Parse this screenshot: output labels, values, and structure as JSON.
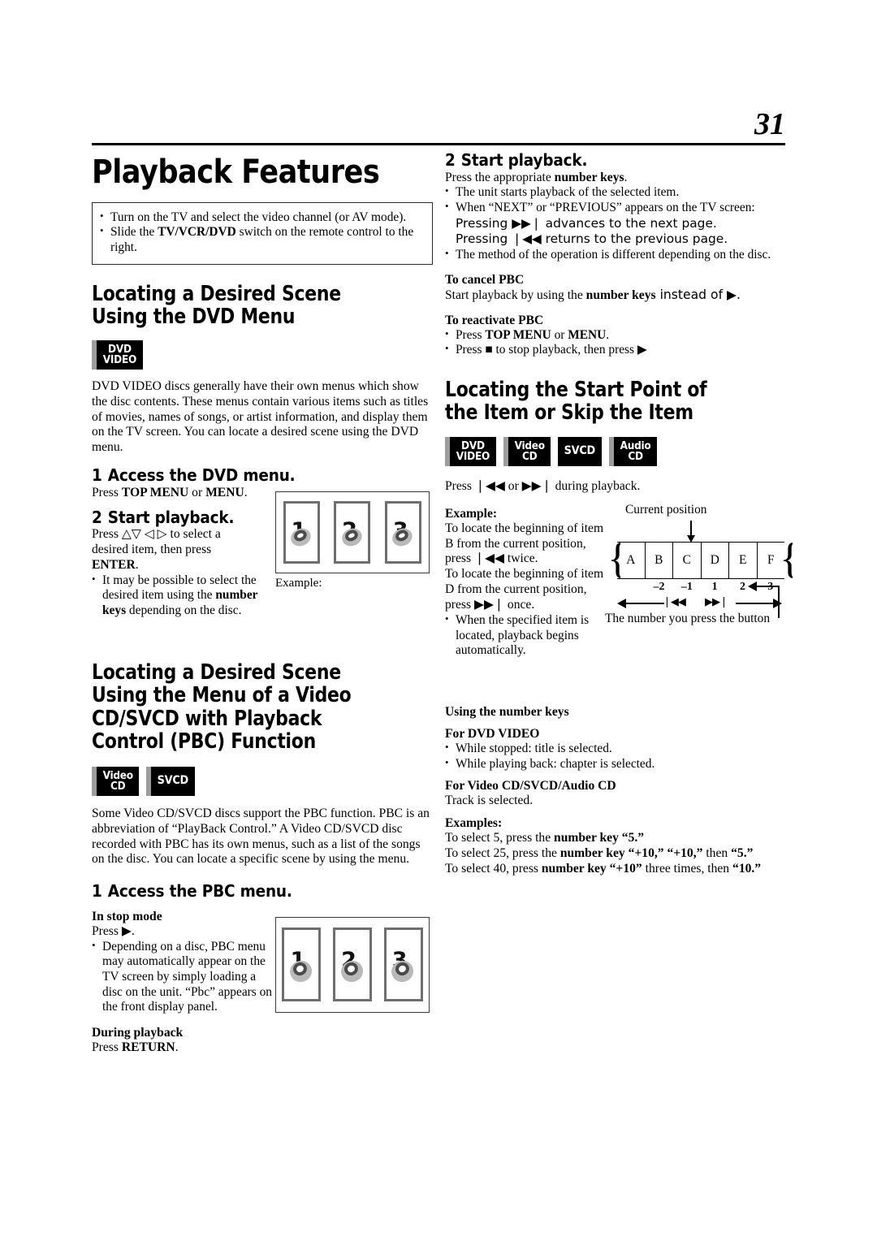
{
  "page": {
    "number": "31"
  },
  "left": {
    "title": "Playback Features",
    "notes": [
      "Turn on the TV and select the video channel (or AV mode).",
      "Slide the TV/VCR/DVD switch on the remote control to the right."
    ],
    "note_bold_1": "TV/VCR/DVD",
    "section1": {
      "heading": "Locating a Desired Scene Using the DVD Menu",
      "badges": [
        {
          "name": "dvd-video-badge",
          "lines": [
            "DVD",
            "VIDEO"
          ],
          "bar": true
        }
      ],
      "body": "DVD VIDEO discs generally have their own menus which show the disc contents. These menus contain various items such as titles of movies, names of songs, or artist information, and display them on the TV screen. You can locate a desired scene using the DVD menu.",
      "step1_num": "1",
      "step1_label": "Access the DVD menu.",
      "step1_body_pre": "Press ",
      "step1_body_bold1": "TOP MENU",
      "step1_body_mid": " or ",
      "step1_body_bold2": "MENU",
      "step1_body_post": ".",
      "step2_num": "2",
      "step2_label": "Start playback.",
      "step2_line1": "Press △▽ ◁ ▷ to select a",
      "step2_line2": "desired item, then press",
      "step2_line3_bold": "ENTER",
      "step2_line3_post": ".",
      "step2_bullet_a": "It may be possible to select the desired item using the ",
      "step2_bullet_b": "number keys",
      "step2_bullet_c": " depending on the disc.",
      "example_caption": "Example:",
      "panels": [
        "1",
        "2",
        "3"
      ]
    },
    "section2": {
      "heading": "Locating a Desired Scene Using the Menu of a Video CD/SVCD with Playback Control (PBC) Function",
      "badges": [
        {
          "name": "video-cd-badge",
          "lines": [
            "Video",
            "CD"
          ],
          "bar": true
        },
        {
          "name": "svcd-badge",
          "lines": [
            "SVCD"
          ],
          "bar": true
        }
      ],
      "body": "Some Video CD/SVCD discs support the PBC function. PBC is an abbreviation of “PlayBack Control.” A Video CD/SVCD disc recorded with PBC has its own menus, such as a list of the songs on the disc. You can locate a specific scene by using the menu.",
      "step1_num": "1",
      "step1_label": "Access the PBC menu.",
      "stop_mode_heading": "In stop mode",
      "stop_mode_press": "Press ▶.",
      "stop_mode_bullet": "Depending on a disc, PBC menu may automatically appear on the TV screen by simply loading a disc on the unit. “Pbc” appears on the front display panel.",
      "during_playback_heading": "During playback",
      "during_playback_press_pre": "Press ",
      "during_playback_press_bold": "RETURN",
      "during_playback_press_post": ".",
      "panels": [
        "1",
        "2",
        "3"
      ]
    }
  },
  "right": {
    "step2_num": "2",
    "step2_label": "Start playback.",
    "step2_lead_pre": "Press the appropriate ",
    "step2_lead_bold": "number keys",
    "step2_lead_post": ".",
    "step2_bullets": [
      "The unit starts playback of the selected item.",
      "When “NEXT” or “PREVIOUS” appears on the TV screen:",
      "The method of the operation is different depending on the disc."
    ],
    "step2_sub_line1": "Pressing ▶▶❘ advances to the next page.",
    "step2_sub_line2": "Pressing ❘◀◀ returns to the previous page.",
    "cancel_pbc_heading": "To cancel PBC",
    "cancel_pbc_pre": "Start playback by using the ",
    "cancel_pbc_bold": "number keys",
    "cancel_pbc_post": " instead of ▶.",
    "reactivate_pbc_heading": "To reactivate PBC",
    "reactivate_b1_pre": "Press ",
    "reactivate_b1_bold1": "TOP MENU",
    "reactivate_b1_mid": " or ",
    "reactivate_b1_bold2": "MENU",
    "reactivate_b1_post": ".",
    "reactivate_b2": "Press ■ to stop playback, then press ▶",
    "section3": {
      "heading": "Locating the Start Point of the Item or Skip the Item",
      "badges": [
        {
          "name": "dvd-video-badge",
          "lines": [
            "DVD",
            "VIDEO"
          ],
          "bar": true
        },
        {
          "name": "video-cd-badge",
          "lines": [
            "Video",
            "CD"
          ],
          "bar": true
        },
        {
          "name": "svcd-badge",
          "lines": [
            "SVCD"
          ],
          "bar": false
        },
        {
          "name": "audio-cd-badge",
          "lines": [
            "Audio",
            "CD"
          ],
          "bar": true
        }
      ],
      "press_line": "Press ❘◀◀ or ▶▶❘ during playback.",
      "example_heading": "Example:",
      "example_body_1": "To locate the beginning of item B from the current position, press ❘◀◀ twice.",
      "example_body_2": "To locate the beginning of item D from the current position, press ▶▶❘ once.",
      "example_bullet": "When the specified item is located, playback begins automatically.",
      "diagram": {
        "caption_top": "Current position",
        "caption_bottom": "The number you press the button",
        "items": [
          "A",
          "B",
          "C",
          "D",
          "E",
          "F"
        ],
        "ticks": [
          "",
          "–2",
          "–1",
          "1",
          "2",
          "3"
        ],
        "back_glyph": "❘◀◀",
        "fwd_glyph": "▶▶❘"
      }
    },
    "number_keys": {
      "heading_normal": "Using the ",
      "heading_bold": "number keys",
      "dvd_heading": "For DVD VIDEO",
      "dvd_bullets": [
        "While stopped: title is selected.",
        "While playing back: chapter is selected."
      ],
      "vcd_heading": "For Video CD/SVCD/Audio CD",
      "vcd_body": "Track is selected.",
      "examples_heading": "Examples:",
      "example_1_pre": "To select 5, press the ",
      "example_1_bold": "number key “5.”",
      "example_2_pre": "To select 25, press the ",
      "example_2_bold1": "number key “+10,” “+10,”",
      "example_2_mid": " then ",
      "example_2_bold2": "“5.”",
      "example_3_pre": "To select 40, press ",
      "example_3_bold1": "number key “+10”",
      "example_3_mid": " three times, then ",
      "example_3_bold2": "“10.”"
    }
  }
}
